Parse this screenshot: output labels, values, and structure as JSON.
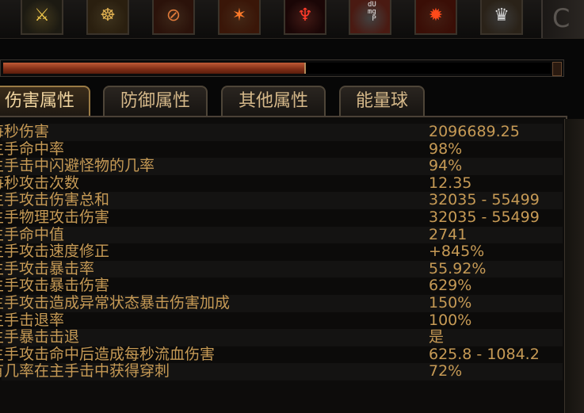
{
  "skills": [
    {
      "name": "sword-skill-icon",
      "glyph": "⚔",
      "color": "#f2c94c",
      "bg": "#1c1a12"
    },
    {
      "name": "horned-helm-skill-icon",
      "glyph": "☸",
      "color": "#e0b050",
      "bg": "#2a1f0f"
    },
    {
      "name": "circle-slash-skill-icon",
      "glyph": "⊘",
      "color": "#e07a3a",
      "bg": "#2b120a"
    },
    {
      "name": "fire-sword-skill-icon",
      "glyph": "✶",
      "color": "#ff7a2a",
      "bg": "#3a1608"
    },
    {
      "name": "demon-figure-skill-icon",
      "glyph": "♆",
      "color": "#ff3b2a",
      "bg": "#1a0606"
    },
    {
      "name": "dmp-skill-icon",
      "glyph": "",
      "color": "#ffffff",
      "bg": "#4a1a12",
      "text": "dU\nmg\n P"
    },
    {
      "name": "fire-blast-skill-icon",
      "glyph": "✹",
      "color": "#ff4a1a",
      "bg": "#3a0e06"
    },
    {
      "name": "winged-helmet-skill-icon",
      "glyph": "♛",
      "color": "#d8d8d8",
      "bg": "#2a2218"
    }
  ],
  "progress": 0.55,
  "tabs": [
    {
      "label": "伤害属性",
      "active": true
    },
    {
      "label": "防御属性",
      "active": false
    },
    {
      "label": "其他属性",
      "active": false
    },
    {
      "label": "能量球",
      "active": false
    }
  ],
  "stats": [
    {
      "label": "每秒伤害",
      "value": "2096689.25"
    },
    {
      "label": "主手命中率",
      "value": "98%"
    },
    {
      "label": "主手击中闪避怪物的几率",
      "value": "94%"
    },
    {
      "label": "每秒攻击次数",
      "value": "12.35"
    },
    {
      "label": "主手攻击伤害总和",
      "value": "32035 - 55499"
    },
    {
      "label": "主手物理攻击伤害",
      "value": "32035 - 55499"
    },
    {
      "label": "主手命中值",
      "value": "2741"
    },
    {
      "label": "主手攻击速度修正",
      "value": "+845%"
    },
    {
      "label": "主手攻击暴击率",
      "value": "55.92%"
    },
    {
      "label": "主手攻击暴击伤害",
      "value": "629%"
    },
    {
      "label": "主手攻击造成异常状态暴击伤害加成",
      "value": "150%"
    },
    {
      "label": "主手击退率",
      "value": "100%"
    },
    {
      "label": "主手暴击击退",
      "value": "是"
    },
    {
      "label": "主手攻击命中后造成每秒流血伤害",
      "value": "625.8 - 1084.2"
    },
    {
      "label": "有几率在主手击中获得穿刺",
      "value": "72%"
    }
  ]
}
